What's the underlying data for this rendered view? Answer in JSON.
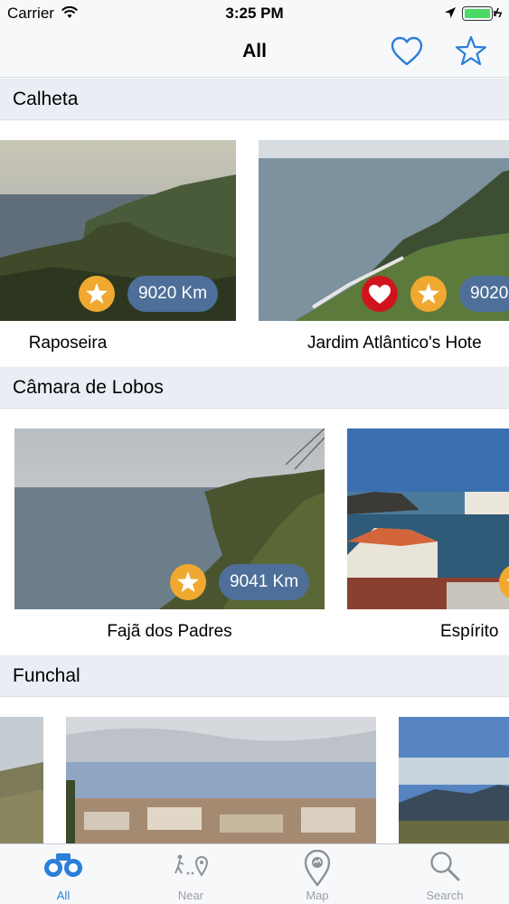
{
  "status_bar": {
    "carrier": "Carrier",
    "time": "3:25 PM",
    "battery_level": 1.0
  },
  "nav": {
    "title": "All",
    "favorites_icon": "heart-outline-icon",
    "starred_icon": "star-outline-icon"
  },
  "sections": [
    {
      "title": "Calheta",
      "cards": [
        {
          "name": "Raposeira",
          "distance": "9020 Km",
          "starred": true,
          "favorite": false
        },
        {
          "name": "Jardim Atlântico's Hote",
          "distance": "9020",
          "starred": true,
          "favorite": true
        }
      ]
    },
    {
      "title": "Câmara de Lobos",
      "cards": [
        {
          "name": "Fajã dos Padres",
          "distance": "9041 Km",
          "starred": true,
          "favorite": false
        },
        {
          "name": "Espírito",
          "distance": "",
          "starred": true,
          "favorite": false
        }
      ]
    },
    {
      "title": "Funchal",
      "cards": []
    }
  ],
  "tabs": [
    {
      "label": "All",
      "icon": "binoculars-icon",
      "active": true
    },
    {
      "label": "Near",
      "icon": "walk-to-pin-icon",
      "active": false
    },
    {
      "label": "Map",
      "icon": "map-pin-icon",
      "active": false
    },
    {
      "label": "Search",
      "icon": "search-icon",
      "active": false
    }
  ],
  "colors": {
    "accent": "#2b7fd8",
    "star_badge": "#f0a830",
    "heart_badge": "#d0141e",
    "distance_badge": "#4d6f99"
  }
}
